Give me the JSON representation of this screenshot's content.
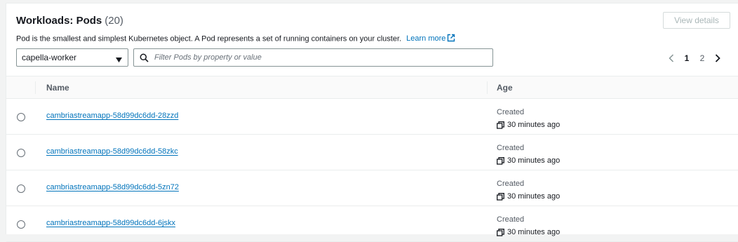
{
  "header": {
    "title": "Workloads: Pods",
    "count": "(20)",
    "description": "Pod is the smallest and simplest Kubernetes object. A Pod represents a set of running containers on your cluster.",
    "learn_more": "Learn more",
    "view_details": "View details"
  },
  "namespace_select": {
    "value": "capella-worker"
  },
  "filter": {
    "placeholder": "Filter Pods by property or value",
    "value": ""
  },
  "pagination": {
    "pages": [
      "1",
      "2"
    ],
    "current": "1"
  },
  "table": {
    "columns": [
      "Name",
      "Age"
    ],
    "rows": [
      {
        "name": "cambriastreamapp-58d99dc6dd-28zzd",
        "created_label": "Created",
        "age": "30 minutes ago"
      },
      {
        "name": "cambriastreamapp-58d99dc6dd-58zkc",
        "created_label": "Created",
        "age": "30 minutes ago"
      },
      {
        "name": "cambriastreamapp-58d99dc6dd-5zn72",
        "created_label": "Created",
        "age": "30 minutes ago"
      },
      {
        "name": "cambriastreamapp-58d99dc6dd-6jskx",
        "created_label": "Created",
        "age": "30 minutes ago"
      }
    ]
  },
  "colors": {
    "link": "#0073bb",
    "text": "#16191f",
    "muted": "#545b64",
    "border": "#eaeded"
  }
}
